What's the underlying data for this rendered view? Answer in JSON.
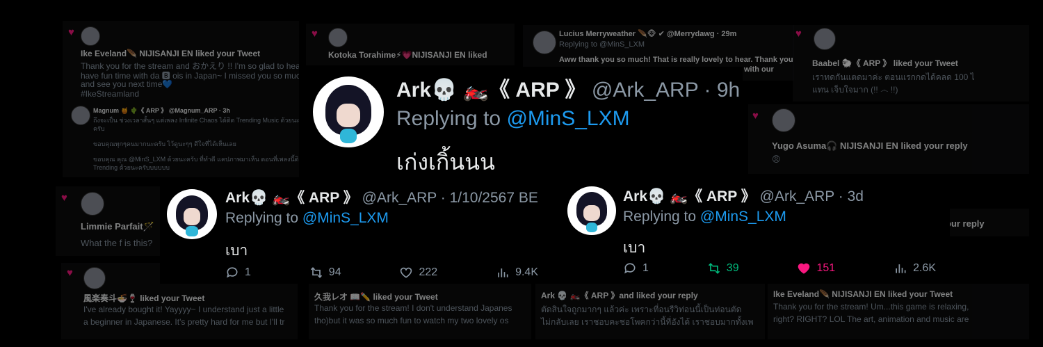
{
  "background_cards": {
    "ike_top": {
      "title": "Ike Eveland🪶 NIJISANJI EN liked your Tweet",
      "lines": [
        "Thank you for the stream and おかえり !! I'm so glad to hear that you",
        "have fun time with da 🅱 ois in Japan~ I missed you so much! Rest w",
        "and see you next time💙",
        "#IkeStreamland"
      ],
      "sub_name": "Magnum 🍯 🌵《 ARP 》 @Magnum_ARP · 3h",
      "sub_lines": [
        "ถึงจะเป็น ช่วงเวลาสั้นๆ แต่เพลง Infinite Chaos ได้ติด Trending Music ด้วยนะ",
        "ครับ",
        "ขอบคุณทุกๆคนมากนะครับ ไว้ดูนะๆๆ ดีใจที่ได้เห็นเลย",
        "ขอบคุณ คุณ @MinS_LXM ด้วยนะครับ ที่ทำดี แคปภาพมาเห็น ตอนที่เพลงนี้ติด",
        "Trending ด้วยนะครับบบบบบ"
      ]
    },
    "kotoka": {
      "title": "Kotoka Torahime⚡💗NIJISANJI EN liked"
    },
    "lucius": {
      "name": "Lucius Merryweather 🪶🐵 ✔ @Merrydawg · 29m",
      "reply": "Replying to @MinS_LXM",
      "lines": [
        "Aww thank you so much! That is really lovely to hear. Thank you for",
        "with our"
      ]
    },
    "baabel": {
      "title": "Baabel 🐑《 ARP 》 liked your Tweet",
      "lines": [
        "เราทดกันแตดมาค่ะ ตอนแรกกดได้คลด 100 ไ",
        "แทน เจ็บใจมาก (!! ෴ !!)"
      ]
    },
    "yugo": {
      "title": "Yugo Asuma🎧 NIJISANJI EN liked your reply",
      "emoji": "😠"
    },
    "limmie": {
      "title": "Limmie Parfait🪄",
      "line": "What the f is this?"
    },
    "right_reply": {
      "text": "our reply"
    },
    "kazura": {
      "title": "風楽奏斗🍜🍷 liked your Tweet",
      "lines": [
        "I've already bought it! Yayyyy~ I understand just a little",
        "a beginner in Japanese. It's pretty hard for me but I'll tr"
      ]
    },
    "kuga": {
      "title": "久我レオ 📖✏️ liked your Tweet",
      "lines": [
        "Thank you for the stream! I don't understand Japanes",
        "tho)but it was so much fun to watch my two lovely os"
      ]
    },
    "ark_liked": {
      "title": "Ark 💀 🏍️《 ARP 》and liked your reply",
      "lines": [
        "ตัดสินใจถูกมากๆ แล้วค่ะ เพราะที่อนรีวิท่อนนี้เป็นท่อนตัด",
        "ไม่กลับเลย เราชอบคะชอโพคกว่านี้ที่อังได้ เราชอบมากทั้งเพ"
      ]
    },
    "ike_bottom": {
      "title": "Ike Eveland🪶 NIJISANJI EN liked your Tweet",
      "lines": [
        "Thank you for the stream! Um...this game is relaxing,",
        "right? RIGHT? LOL The art, animation and music are"
      ]
    }
  },
  "tweet_top": {
    "name": "Ark💀 🏍️《 ARP 》",
    "handle": "@Ark_ARP · 9h",
    "reply_prefix": "Replying to ",
    "mention": "@MinS_LXM",
    "text": "เก่งเกิ้นนน"
  },
  "tweet_left": {
    "name": "Ark💀 🏍️《 ARP 》",
    "handle": "@Ark_ARP · 1/10/2567 BE",
    "reply_prefix": "Replying to ",
    "mention": "@MinS_LXM",
    "text": "เบา",
    "replies": "1",
    "retweets": "94",
    "likes": "222",
    "views": "9.4K"
  },
  "tweet_right": {
    "name": "Ark💀 🏍️《 ARP 》",
    "handle": "@Ark_ARP · 3d",
    "reply_prefix": "Replying to ",
    "mention": "@MinS_LXM",
    "text": "เบา",
    "replies": "1",
    "retweets": "39",
    "likes": "151",
    "views": "2.6K"
  },
  "colors": {
    "accent": "#1d9bf0",
    "like": "#f91880",
    "retweet": "#00ba7c",
    "muted": "#8b98a5"
  }
}
